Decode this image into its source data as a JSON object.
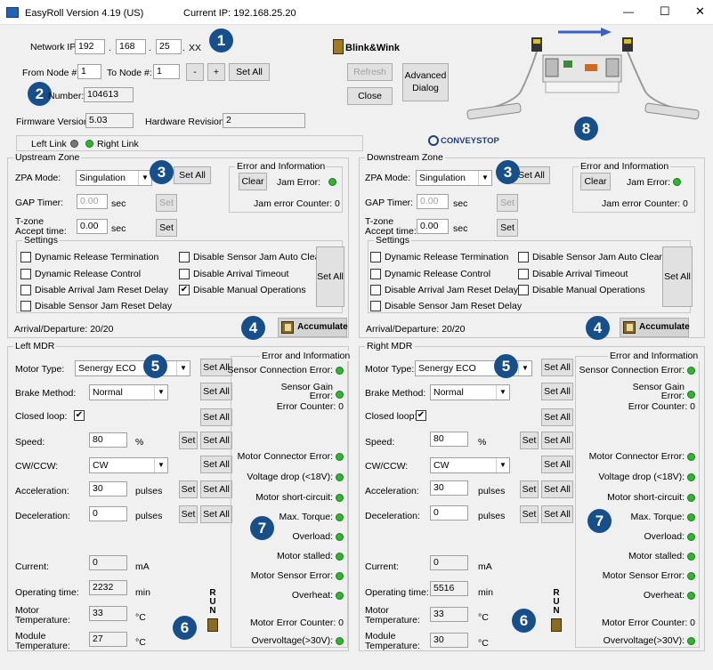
{
  "window": {
    "title": "EasyRoll Version 4.19 (US)",
    "current_ip": "Current IP: 192.168.25.20",
    "minimize": "—",
    "maximize": "☐",
    "close": "✕"
  },
  "network": {
    "label": "Network IP:",
    "ip": [
      "192",
      "168",
      "25"
    ],
    "last": "XX",
    "dot": "."
  },
  "node": {
    "from_label": "From Node #:",
    "from_val": "1",
    "to_label": "To Node #:",
    "to_val": "1",
    "minus": "-",
    "plus": "+",
    "set_all": "Set All"
  },
  "serial": {
    "label": "Number:",
    "value": "104613"
  },
  "firmware": {
    "label": "Firmware Version:",
    "value": "5.03"
  },
  "hardware": {
    "label": "Hardware Revision:",
    "value": "2"
  },
  "links": {
    "left": "Left Link",
    "right": "Right Link"
  },
  "blink": "Blink&Wink",
  "buttons": {
    "refresh": "Refresh",
    "close": "Close",
    "advanced": "Advanced Dialog"
  },
  "logo": "CONVEYSTOP",
  "badges": [
    "1",
    "2",
    "3",
    "4",
    "5",
    "6",
    "7",
    "8"
  ],
  "upstream": {
    "title": "Upstream Zone",
    "zpa_label": "ZPA Mode:",
    "zpa_value": "Singulation",
    "set_all": "Set All",
    "gap_label": "GAP Timer:",
    "gap_value": "0.00",
    "sec": "sec",
    "set": "Set",
    "tzone_label1": "T-zone",
    "tzone_label2": "Accept time:",
    "tzone_value": "0.00",
    "err_title": "Error and Information",
    "clear": "Clear",
    "jam_error": "Jam Error:",
    "jam_counter": "Jam error Counter: 0",
    "settings_title": "Settings",
    "opts": [
      {
        "label": "Dynamic Release Termination",
        "checked": false
      },
      {
        "label": "Disable Sensor Jam Auto Clear",
        "checked": false
      },
      {
        "label": "Dynamic Release Control",
        "checked": false
      },
      {
        "label": "Disable Arrival Timeout",
        "checked": false
      },
      {
        "label": "Disable Arrival Jam Reset Delay",
        "checked": false
      },
      {
        "label": "Disable Manual Operations",
        "checked": true
      },
      {
        "label": "Disable Sensor Jam Reset Delay",
        "checked": false
      }
    ],
    "arrival": "Arrival/Departure: 20/20",
    "accumulate": "Accumulate"
  },
  "downstream": {
    "title": "Downstream Zone",
    "zpa_label": "ZPA Mode:",
    "zpa_value": "Singulation",
    "set_all": "Set All",
    "gap_label": "GAP Timer:",
    "gap_value": "0.00",
    "sec": "sec",
    "set": "Set",
    "tzone_label1": "T-zone",
    "tzone_label2": "Accept time:",
    "tzone_value": "0.00",
    "err_title": "Error and Information",
    "clear": "Clear",
    "jam_error": "Jam Error:",
    "jam_counter": "Jam error Counter: 0",
    "settings_title": "Settings",
    "opts": [
      {
        "label": "Dynamic Release Termination",
        "checked": false
      },
      {
        "label": "Disable Sensor Jam Auto Clear",
        "checked": false
      },
      {
        "label": "Dynamic Release Control",
        "checked": false
      },
      {
        "label": "Disable Arrival Timeout",
        "checked": false
      },
      {
        "label": "Disable Arrival Jam Reset Delay",
        "checked": false
      },
      {
        "label": "Disable Manual Operations",
        "checked": false
      },
      {
        "label": "Disable Sensor Jam Reset Delay",
        "checked": false
      }
    ],
    "arrival": "Arrival/Departure: 20/20",
    "accumulate": "Accumulate"
  },
  "left_mdr": {
    "title": "Left MDR",
    "motor_type_label": "Motor Type:",
    "motor_type": "Senergy ECO",
    "brake_label": "Brake Method:",
    "brake": "Normal",
    "closed_loop": "Closed loop:",
    "speed_label": "Speed:",
    "speed": "80",
    "percent": "%",
    "dir_label": "CW/CCW:",
    "dir": "CW",
    "accel_label": "Acceleration:",
    "accel": "30",
    "decel_label": "Deceleration:",
    "decel": "0",
    "pulses": "pulses",
    "set": "Set",
    "set_all": "Set All",
    "current_label": "Current:",
    "current": "0",
    "ma": "mA",
    "op_label": "Operating time:",
    "op": "2232",
    "min": "min",
    "motor_temp_label1": "Motor",
    "motor_temp_label2": "Temperature:",
    "motor_temp": "33",
    "module_temp_label1": "Module",
    "module_temp_label2": "Temperature:",
    "module_temp": "27",
    "deg": "°C",
    "run": [
      "R",
      "U",
      "N"
    ],
    "err_title": "Error and Information",
    "errs": {
      "sensor_conn": "Sensor Connection Error:",
      "gain1": "Sensor Gain",
      "gain2": "Error:",
      "err_counter": "Error Counter: 0",
      "motor_conn": "Motor Connector Error:",
      "vdrop": "Voltage drop (<18V):",
      "short": "Motor short-circuit:",
      "torque": "Max. Torque:",
      "overload": "Overload:",
      "stalled": "Motor stalled:",
      "motor_sensor": "Motor Sensor Error:",
      "overheat": "Overheat:",
      "motor_err_counter": "Motor Error Counter: 0",
      "overvolt": "Overvoltage(>30V):"
    }
  },
  "right_mdr": {
    "title": "Right MDR",
    "motor_type_label": "Motor Type:",
    "motor_type": "Senergy ECO",
    "brake_label": "Brake Method:",
    "brake": "Normal",
    "closed_loop": "Closed loop:",
    "speed_label": "Speed:",
    "speed": "80",
    "percent": "%",
    "dir_label": "CW/CCW:",
    "dir": "CW",
    "accel_label": "Acceleration:",
    "accel": "30",
    "decel_label": "Deceleration:",
    "decel": "0",
    "pulses": "pulses",
    "set": "Set",
    "set_all": "Set All",
    "current_label": "Current:",
    "current": "0",
    "ma": "mA",
    "op_label": "Operating time:",
    "op": "5516",
    "min": "min",
    "motor_temp_label1": "Motor",
    "motor_temp_label2": "Temperature:",
    "motor_temp": "33",
    "module_temp_label1": "Module",
    "module_temp_label2": "Temperature:",
    "module_temp": "30",
    "deg": "°C",
    "run": [
      "R",
      "U",
      "N"
    ],
    "err_title": "Error and Information",
    "errs": {
      "sensor_conn": "Sensor Connection Error:",
      "gain1": "Sensor Gain",
      "gain2": "Error:",
      "err_counter": "Error Counter: 0",
      "motor_conn": "Motor Connector Error:",
      "vdrop": "Voltage drop (<18V):",
      "short": "Motor short-circuit:",
      "torque": "Max. Torque:",
      "overload": "Overload:",
      "stalled": "Motor stalled:",
      "motor_sensor": "Motor Sensor Error:",
      "overheat": "Overheat:",
      "motor_err_counter": "Motor Error Counter: 0",
      "overvolt": "Overvoltage(>30V):"
    }
  },
  "colors": {
    "led_green": "#2fb52f",
    "badge": "#174f8a",
    "arrow": "#3a5fc8"
  }
}
